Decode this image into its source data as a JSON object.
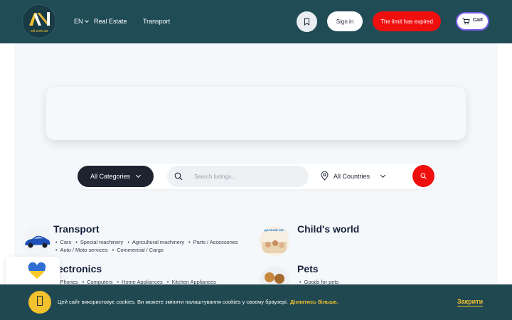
{
  "header": {
    "logo_text": "oxl.com.ua",
    "language": "EN",
    "nav": [
      "Real Estate",
      "Transport"
    ],
    "signin_label": "Sign in",
    "limit_label": "The limit has expired",
    "cart_label": "Cart",
    "colors": {
      "bg": "#204c56",
      "limit": "#ef0f0f",
      "cart_border": "#7a5cf0"
    }
  },
  "search": {
    "categories_label": "All Categories",
    "placeholder": "Search listings...",
    "countries_label": "All Countries"
  },
  "categories": [
    {
      "title": "Transport",
      "icon": "car-image",
      "subcategories": [
        "Cars",
        "Special machinery",
        "Agricultural machinery",
        "Parts / Accessories",
        "Auto / Moto services",
        "Commercial / Cargo"
      ]
    },
    {
      "title": "Child's world",
      "icon": "kids-image",
      "image_text": "Дитячий світ",
      "subcategories": []
    },
    {
      "title": "lectronics",
      "icon": "electronics-image",
      "subcategories": [
        "Phones",
        "Computers",
        "Home Appliances",
        "Kitchen Appliances"
      ]
    },
    {
      "title": "Pets",
      "icon": "pets-image",
      "subcategories": [
        "Goods for pets"
      ]
    }
  ],
  "cookie": {
    "text": "Цей сайт використовує cookies. Ви можете змінити налаштування cookies у своєму браузері.",
    "link": "Дізнатись більше.",
    "close": "Закрити"
  },
  "flag_icon": "ukraine-heart-icon"
}
